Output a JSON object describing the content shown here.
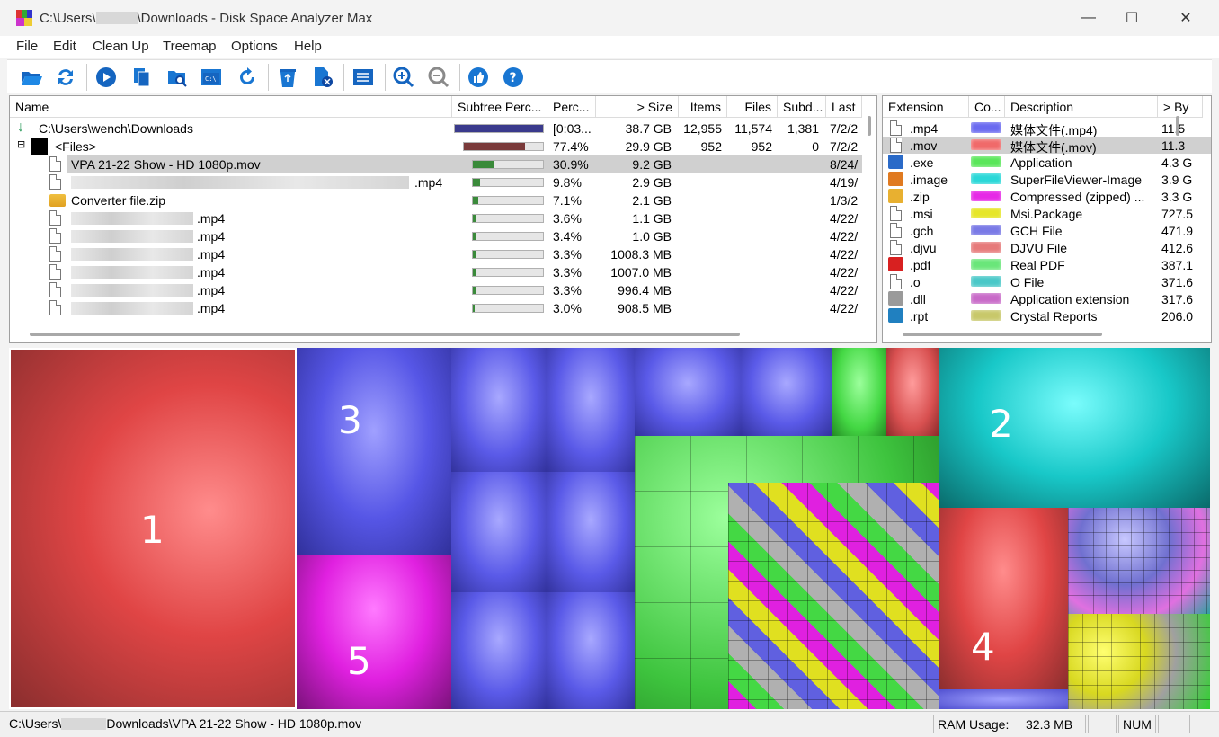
{
  "window": {
    "title_prefix": "C:\\Users\\",
    "title_suffix": "\\Downloads - Disk Space Analyzer Max",
    "minimize": "—",
    "maximize": "☐",
    "close": "✕"
  },
  "menu": [
    "File",
    "Edit",
    "Clean Up",
    "Treemap",
    "Options",
    "Help"
  ],
  "toolbar": {
    "icons": [
      "open-folder-icon",
      "refresh-icon",
      "play-icon",
      "copy-icon",
      "find-folder-icon",
      "console-icon",
      "reload-icon",
      "recycle-icon",
      "delete-file-icon",
      "list-view-icon",
      "zoom-in-icon",
      "zoom-out-icon",
      "thumbs-up-icon",
      "help-icon"
    ]
  },
  "tree": {
    "headers": [
      "Name",
      "Subtree Perc...",
      "Perc...",
      "> Size",
      "Items",
      "Files",
      "Subd...",
      "Last"
    ],
    "rows": [
      {
        "name": "C:\\Users\\wench\\Downloads",
        "perc": "[0:03...",
        "size": "38.7 GB",
        "items": "12,955",
        "files": "11,574",
        "subdirs": "1,381",
        "last": "7/2/2",
        "bar": 1.0,
        "color": "#3a3a8c"
      },
      {
        "name": "<Files>",
        "perc": "77.4%",
        "size": "29.9 GB",
        "items": "952",
        "files": "952",
        "subdirs": "0",
        "last": "7/2/2",
        "bar": 0.774,
        "color": "#7a3a3a"
      },
      {
        "name": "VPA 21-22 Show - HD 1080p.mov",
        "perc": "30.9%",
        "size": "9.2 GB",
        "items": "",
        "files": "",
        "subdirs": "",
        "last": "8/24/",
        "bar": 0.309,
        "color": "#3a8a3a"
      },
      {
        "name": ".mp4",
        "perc": "9.8%",
        "size": "2.9 GB",
        "items": "",
        "files": "",
        "subdirs": "",
        "last": "4/19/",
        "bar": 0.098,
        "color": "#3a8a3a"
      },
      {
        "name": "Converter file.zip",
        "perc": "7.1%",
        "size": "2.1 GB",
        "items": "",
        "files": "",
        "subdirs": "",
        "last": "1/3/2",
        "bar": 0.071,
        "color": "#3a8a3a"
      },
      {
        "name": ".mp4",
        "perc": "3.6%",
        "size": "1.1 GB",
        "items": "",
        "files": "",
        "subdirs": "",
        "last": "4/22/",
        "bar": 0.036,
        "color": "#3a8a3a"
      },
      {
        "name": ".mp4",
        "perc": "3.4%",
        "size": "1.0 GB",
        "items": "",
        "files": "",
        "subdirs": "",
        "last": "4/22/",
        "bar": 0.034,
        "color": "#3a8a3a"
      },
      {
        "name": ".mp4",
        "perc": "3.3%",
        "size": "1008.3 MB",
        "items": "",
        "files": "",
        "subdirs": "",
        "last": "4/22/",
        "bar": 0.033,
        "color": "#3a8a3a"
      },
      {
        "name": ".mp4",
        "perc": "3.3%",
        "size": "1007.0 MB",
        "items": "",
        "files": "",
        "subdirs": "",
        "last": "4/22/",
        "bar": 0.033,
        "color": "#3a8a3a"
      },
      {
        "name": ".mp4",
        "perc": "3.3%",
        "size": "996.4 MB",
        "items": "",
        "files": "",
        "subdirs": "",
        "last": "4/22/",
        "bar": 0.033,
        "color": "#3a8a3a"
      },
      {
        "name": ".mp4",
        "perc": "3.0%",
        "size": "908.5 MB",
        "items": "",
        "files": "",
        "subdirs": "",
        "last": "4/22/",
        "bar": 0.03,
        "color": "#3a8a3a"
      }
    ]
  },
  "extensions": {
    "headers": [
      "Extension",
      "Co...",
      "Description",
      "> By"
    ],
    "rows": [
      {
        "ext": ".mp4",
        "color": "#6a6af0",
        "desc": "媒体文件(.mp4)",
        "bytes": "11.5"
      },
      {
        "ext": ".mov",
        "color": "#f06a6a",
        "desc": "媒体文件(.mov)",
        "bytes": "11.3"
      },
      {
        "ext": ".exe",
        "color": "#5ae65a",
        "desc": "Application",
        "bytes": "4.3 G"
      },
      {
        "ext": ".image",
        "color": "#2ad8d8",
        "desc": "SuperFileViewer-Image",
        "bytes": "3.9 G"
      },
      {
        "ext": ".zip",
        "color": "#e62ae6",
        "desc": "Compressed (zipped) ...",
        "bytes": "3.3 G"
      },
      {
        "ext": ".msi",
        "color": "#e6e62a",
        "desc": "Msi.Package",
        "bytes": "727.5"
      },
      {
        "ext": ".gch",
        "color": "#7a7ae6",
        "desc": "GCH File",
        "bytes": "471.9"
      },
      {
        "ext": ".djvu",
        "color": "#e67a7a",
        "desc": "DJVU File",
        "bytes": "412.6"
      },
      {
        "ext": ".pdf",
        "color": "#6ae67a",
        "desc": "Real PDF",
        "bytes": "387.1"
      },
      {
        "ext": ".o",
        "color": "#4ac8c8",
        "desc": "O File",
        "bytes": "371.6"
      },
      {
        "ext": ".dll",
        "color": "#c86ac8",
        "desc": "Application extension",
        "bytes": "317.6"
      },
      {
        "ext": ".rpt",
        "color": "#c8c86a",
        "desc": "Crystal Reports",
        "bytes": "206.0"
      }
    ]
  },
  "treemap": {
    "labels": [
      "1",
      "2",
      "3",
      "4",
      "5"
    ]
  },
  "status": {
    "path_prefix": "C:\\Users\\",
    "path_suffix": "Downloads\\VPA 21-22 Show - HD 1080p.mov",
    "ram_label": "RAM Usage:",
    "ram_value": "32.3 MB",
    "num": "NUM"
  }
}
